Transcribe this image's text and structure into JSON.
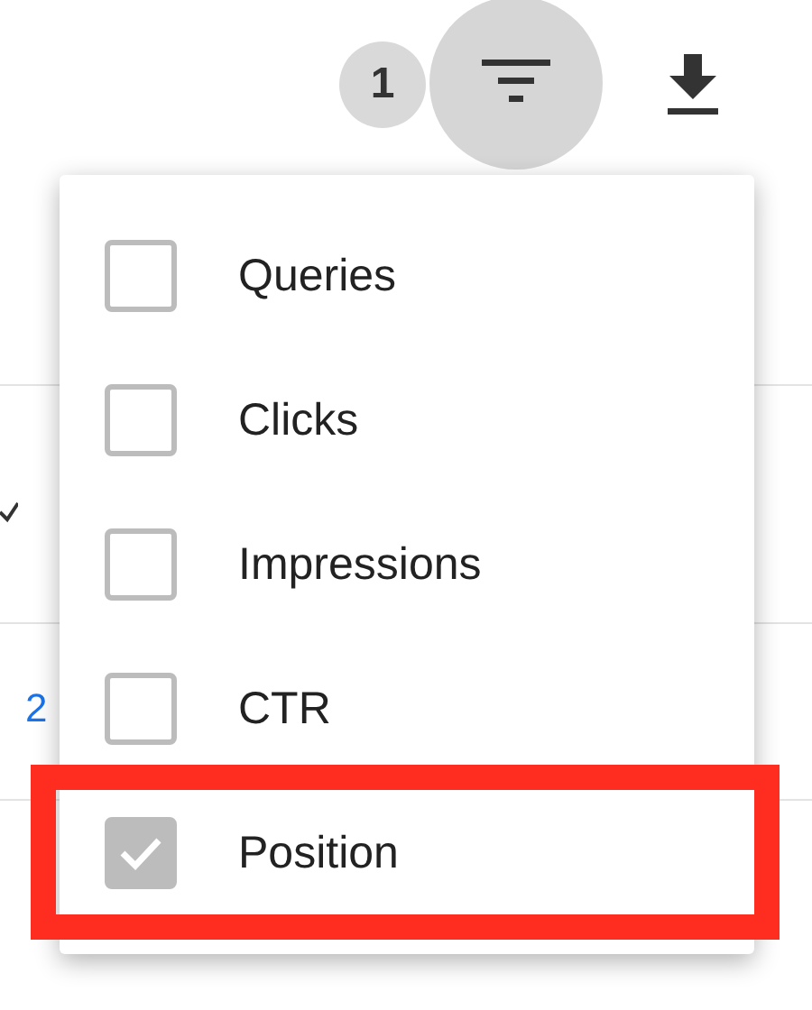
{
  "toolbar": {
    "filter_count": "1"
  },
  "background": {
    "row_text": "2"
  },
  "menu": {
    "items": [
      {
        "label": "Queries",
        "checked": false,
        "highlighted": false
      },
      {
        "label": "Clicks",
        "checked": false,
        "highlighted": false
      },
      {
        "label": "Impressions",
        "checked": false,
        "highlighted": false
      },
      {
        "label": "CTR",
        "checked": false,
        "highlighted": false
      },
      {
        "label": "Position",
        "checked": true,
        "highlighted": true
      }
    ]
  }
}
